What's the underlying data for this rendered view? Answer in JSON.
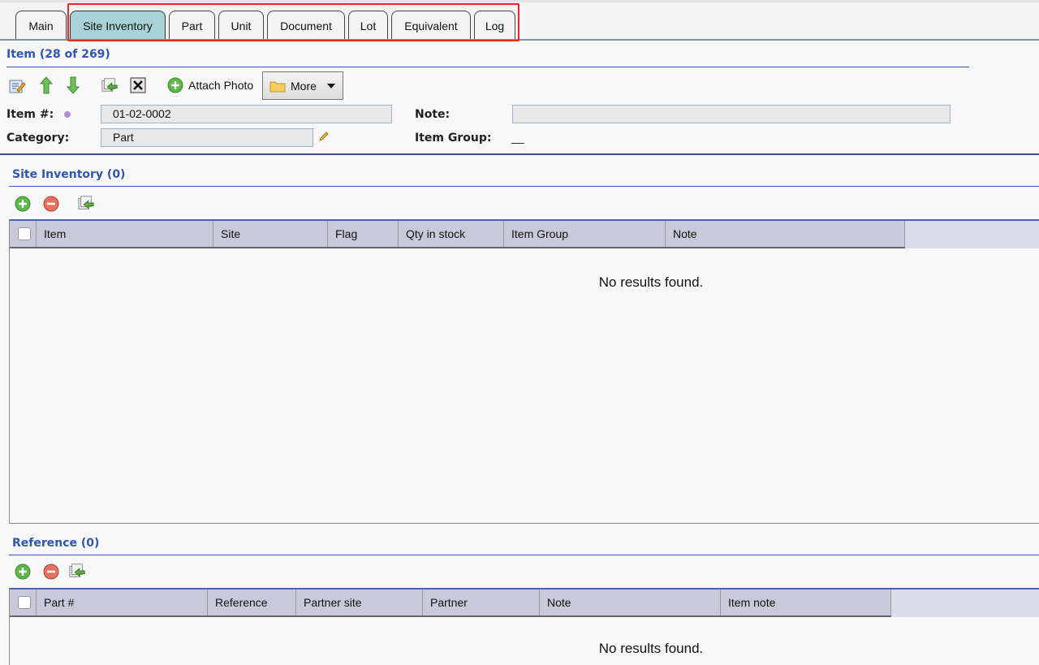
{
  "tabs": [
    {
      "label": "Main"
    },
    {
      "label": "Site Inventory"
    },
    {
      "label": "Part"
    },
    {
      "label": "Unit"
    },
    {
      "label": "Document"
    },
    {
      "label": "Lot"
    },
    {
      "label": "Equivalent"
    },
    {
      "label": "Log"
    }
  ],
  "active_tab": "Site Inventory",
  "item_header": {
    "title": "Item (28 of 269)"
  },
  "toolbar": {
    "edit_icon": "edit-icon",
    "up_icon": "arrow-up-icon",
    "down_icon": "arrow-down-icon",
    "export_icon": "export-icon",
    "delete_icon": "delete-icon",
    "attach_label": "Attach Photo",
    "more_label": "More"
  },
  "form": {
    "item_no_label": "Item #:",
    "item_no_value": "01-02-0002",
    "category_label": "Category:",
    "category_value": "Part",
    "note_label": "Note:",
    "note_value": "",
    "item_group_label": "Item Group:",
    "item_group_value": "__"
  },
  "site_inventory": {
    "title": "Site Inventory (0)",
    "columns": [
      "Item",
      "Site",
      "Flag",
      "Qty in stock",
      "Item Group",
      "Note"
    ],
    "empty_text": "No results found."
  },
  "reference": {
    "title": "Reference (0)",
    "columns": [
      "Part #",
      "Reference",
      "Partner site",
      "Partner",
      "Note",
      "Item note"
    ],
    "empty_text": "No results found."
  },
  "colors": {
    "active_tab": "#a8d3d6",
    "section_title": "#2f56b0",
    "grid_header": "#c9c9db",
    "highlight": "#e8262a"
  }
}
